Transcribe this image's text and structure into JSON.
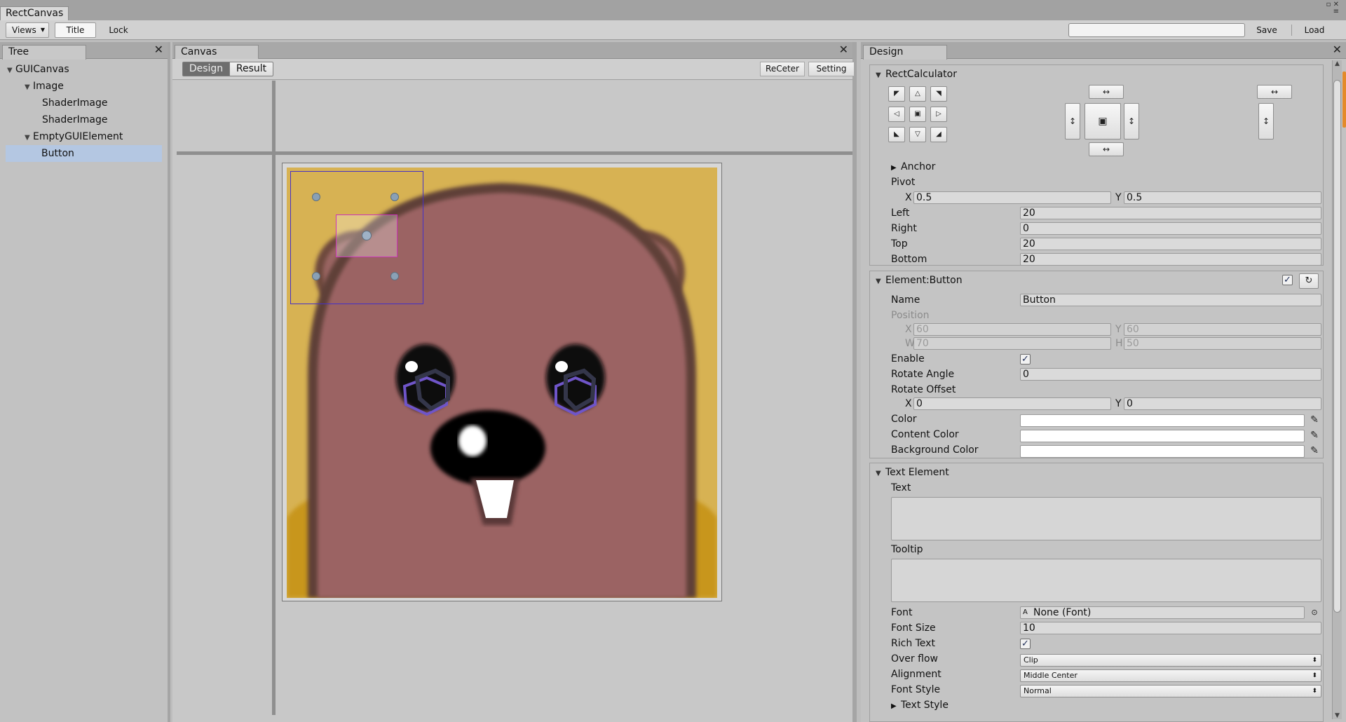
{
  "window": {
    "tab": "RectCanvas",
    "controls": "▫ ✕\n≡"
  },
  "toolbar": {
    "views": "Views",
    "title": "Title",
    "lock": "Lock",
    "search_value": "",
    "save": "Save",
    "load": "Load"
  },
  "tree": {
    "header": "Tree",
    "items": [
      {
        "label": "GUICanvas",
        "expanded": true
      },
      {
        "label": "Image",
        "expanded": true
      },
      {
        "label": "ShaderImage"
      },
      {
        "label": "ShaderImage"
      },
      {
        "label": "EmptyGUIElement",
        "expanded": true
      },
      {
        "label": "Button",
        "selected": true
      }
    ]
  },
  "canvas": {
    "header": "Canvas",
    "design_tab": "Design",
    "result_tab": "Result",
    "recenter": "ReCeter",
    "setting": "Setting"
  },
  "design": {
    "header": "Design",
    "rect": {
      "title": "RectCalculator",
      "anchor": "Anchor",
      "pivot": "Pivot",
      "pivot_x_label": "X",
      "pivot_x": "0.5",
      "pivot_y_label": "Y",
      "pivot_y": "0.5",
      "left_label": "Left",
      "left": "20",
      "right_label": "Right",
      "right": "0",
      "top_label": "Top",
      "top": "20",
      "bottom_label": "Bottom",
      "bottom": "20"
    },
    "element": {
      "title": "Element:Button",
      "enabled": true,
      "name_label": "Name",
      "name": "Button",
      "position_label": "Position",
      "pos_x_label": "X",
      "pos_x": "60",
      "pos_y_label": "Y",
      "pos_y": "60",
      "pos_w_label": "W",
      "pos_w": "70",
      "pos_h_label": "H",
      "pos_h": "50",
      "enable_label": "Enable",
      "enable": true,
      "rotate_angle_label": "Rotate Angle",
      "rotate_angle": "0",
      "rotate_offset_label": "Rotate Offset",
      "rot_x_label": "X",
      "rot_x": "0",
      "rot_y_label": "Y",
      "rot_y": "0",
      "color_label": "Color",
      "content_color_label": "Content Color",
      "background_color_label": "Background Color",
      "color": "#ffffff",
      "content_color": "#ffffff",
      "background_color": "#ffffff"
    },
    "text": {
      "title": "Text Element",
      "text_label": "Text",
      "text_value": "",
      "tooltip_label": "Tooltip",
      "tooltip_value": "",
      "font_label": "Font",
      "font": "None (Font)",
      "font_size_label": "Font Size",
      "font_size": "10",
      "rich_text_label": "Rich Text",
      "rich_text": true,
      "overflow_label": "Over flow",
      "overflow": "Clip",
      "alignment_label": "Alignment",
      "alignment": "Middle Center",
      "font_style_label": "Font Style",
      "font_style": "Normal",
      "text_style": "Text Style"
    }
  },
  "colors": {
    "accent_orange": "#e48a2a",
    "selection": "#b4c7e2",
    "anchor_rect": "#4530c7",
    "button_rect": "#cc33bb"
  }
}
